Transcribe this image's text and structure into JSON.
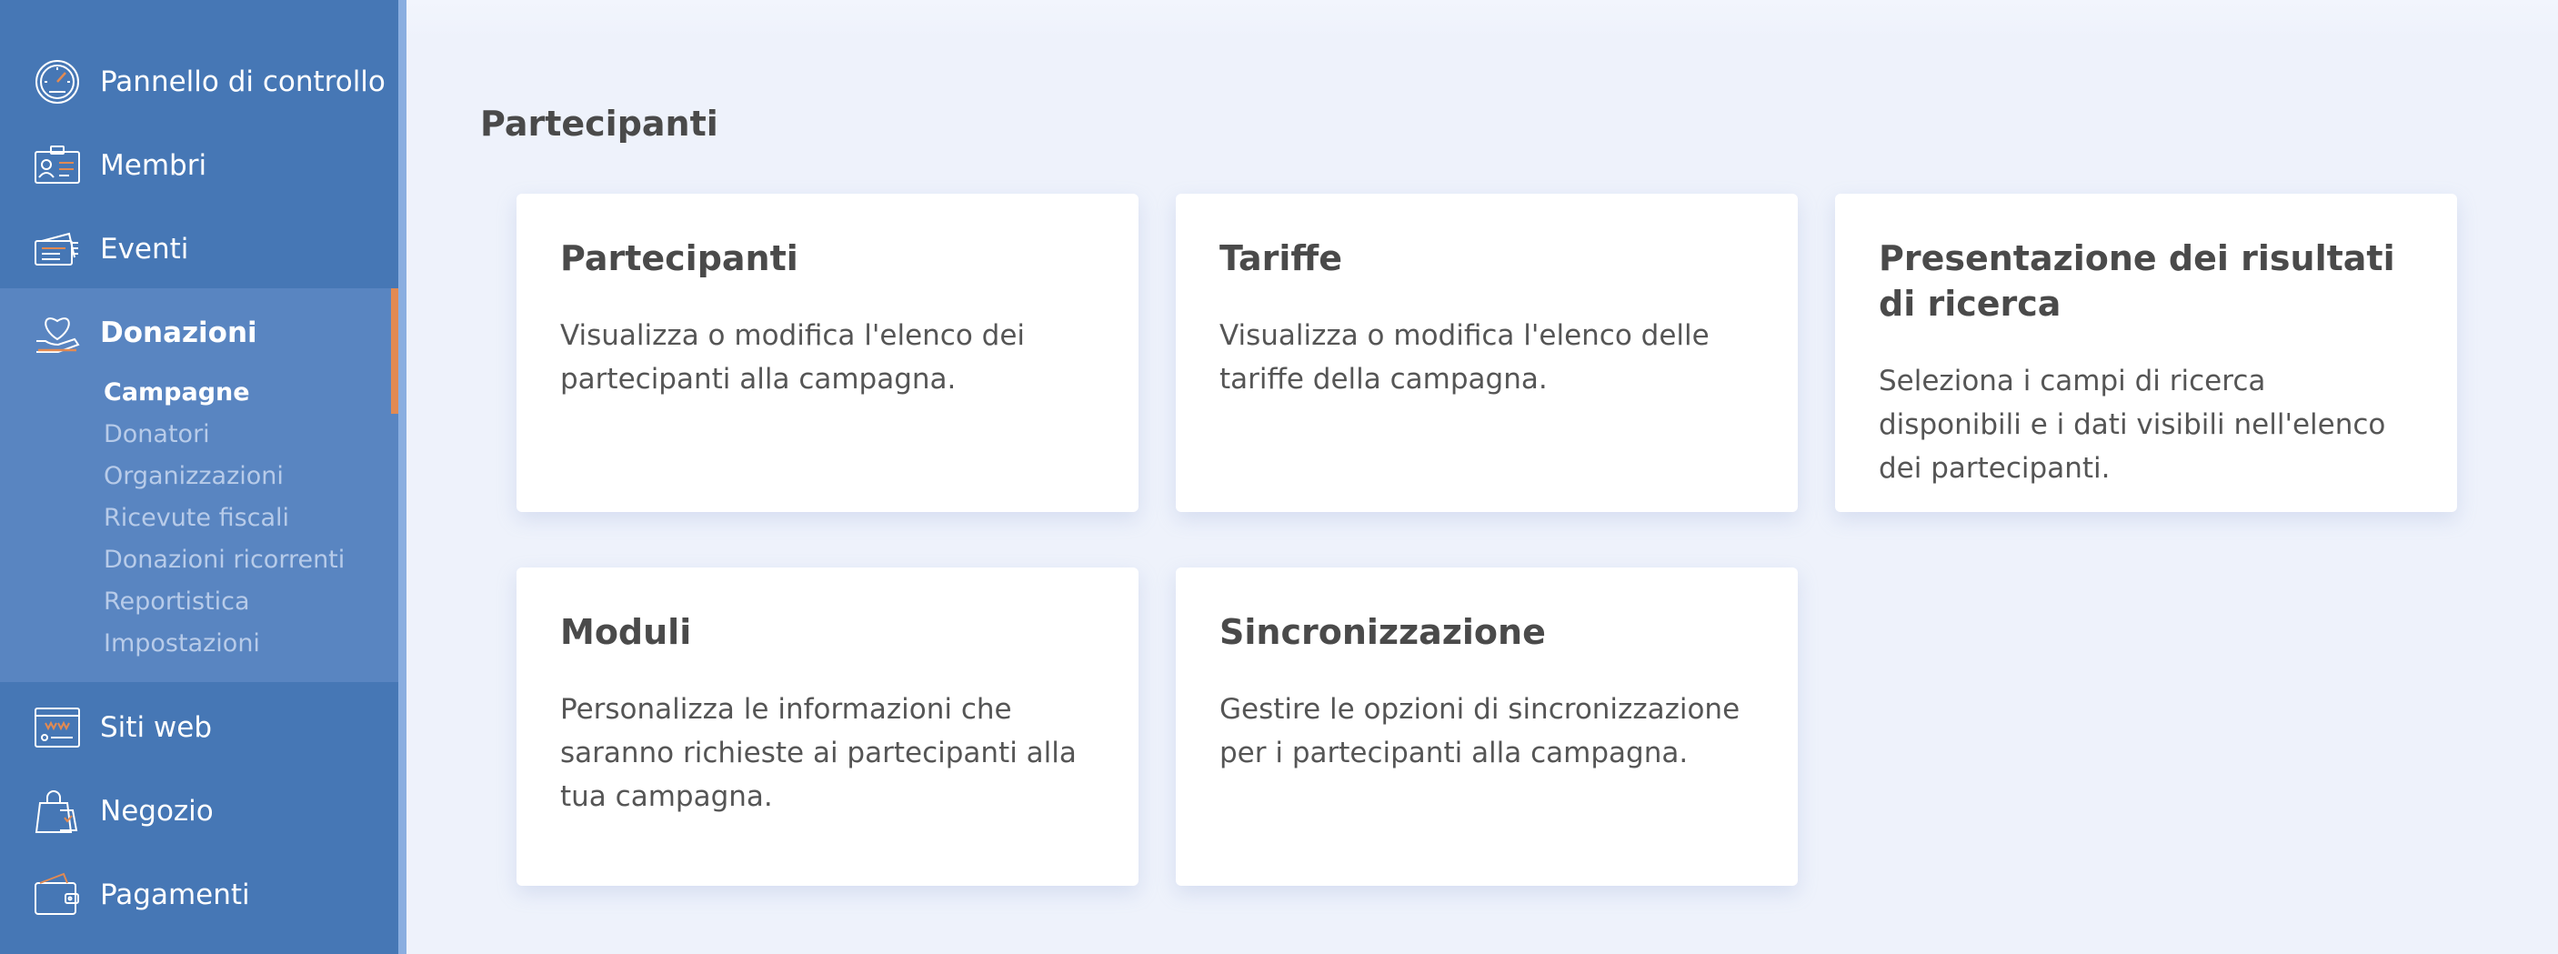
{
  "sidebar": {
    "items": [
      {
        "label": "Pannello di controllo",
        "icon": "speedometer-icon"
      },
      {
        "label": "Membri",
        "icon": "id-card-icon"
      },
      {
        "label": "Eventi",
        "icon": "tickets-icon"
      },
      {
        "label": "Donazioni",
        "icon": "heart-hand-icon"
      },
      {
        "label": "Siti web",
        "icon": "website-icon"
      },
      {
        "label": "Negozio",
        "icon": "shopping-bag-icon"
      },
      {
        "label": "Pagamenti",
        "icon": "wallet-icon"
      }
    ],
    "subitems": [
      "Campagne",
      "Donatori",
      "Organizzazioni",
      "Ricevute fiscali",
      "Donazioni ricorrenti",
      "Reportistica",
      "Impostazioni"
    ]
  },
  "main": {
    "title": "Partecipanti",
    "cards": [
      {
        "title": "Partecipanti",
        "desc": "Visualizza o modifica l'elenco dei partecipanti alla campagna."
      },
      {
        "title": "Tariffe",
        "desc": "Visualizza o modifica l'elenco delle tariffe della campagna."
      },
      {
        "title": "Presentazione dei risultati di ricerca",
        "desc": "Seleziona i campi di ricerca disponibili e i dati visibili nell'elenco dei partecipanti."
      },
      {
        "title": "Moduli",
        "desc": "Personalizza le informazioni che saranno richieste ai partecipanti alla tua campagna."
      },
      {
        "title": "Sincronizzazione",
        "desc": "Gestire le opzioni di sincronizzazione per i partecipanti alla campagna."
      }
    ]
  },
  "colors": {
    "sidebar": "#4677b5",
    "active_group": "#5985c1",
    "accent": "#e28a52",
    "background": "#eef2fb"
  }
}
